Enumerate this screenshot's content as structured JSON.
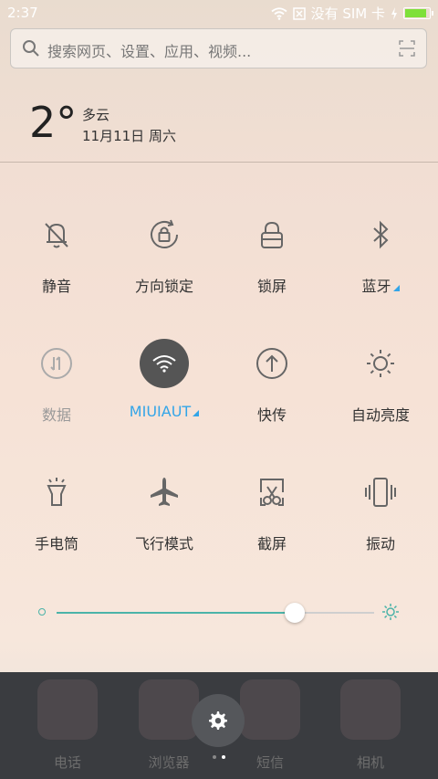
{
  "status": {
    "time": "2:37",
    "carrier": "没有 SIM 卡"
  },
  "search": {
    "placeholder": "搜索网页、设置、应用、视频..."
  },
  "weather": {
    "temp": "2°",
    "condition": "多云",
    "date": "11月11日 周六"
  },
  "toggles": [
    {
      "label": "静音",
      "icon": "bell-off-icon",
      "state": "off"
    },
    {
      "label": "方向锁定",
      "icon": "rotation-lock-icon",
      "state": "off"
    },
    {
      "label": "锁屏",
      "icon": "lock-icon",
      "state": "off"
    },
    {
      "label": "蓝牙",
      "icon": "bluetooth-icon",
      "state": "off",
      "has_menu": true
    },
    {
      "label": "数据",
      "icon": "mobile-data-icon",
      "state": "disabled"
    },
    {
      "label": "MIUIAUT",
      "icon": "wifi-icon",
      "state": "on",
      "has_menu": true
    },
    {
      "label": "快传",
      "icon": "share-upload-icon",
      "state": "off"
    },
    {
      "label": "自动亮度",
      "icon": "auto-brightness-icon",
      "state": "off"
    },
    {
      "label": "手电筒",
      "icon": "flashlight-icon",
      "state": "off"
    },
    {
      "label": "飞行模式",
      "icon": "airplane-icon",
      "state": "off"
    },
    {
      "label": "截屏",
      "icon": "screenshot-icon",
      "state": "off"
    },
    {
      "label": "振动",
      "icon": "vibrate-icon",
      "state": "off"
    }
  ],
  "brightness": {
    "level": 0.75
  },
  "dock": {
    "apps": [
      "电话",
      "浏览器",
      "短信",
      "相机"
    ]
  },
  "colors": {
    "accent": "#33a5e8",
    "slider": "#4bb3a8",
    "dock": "#3a3c40"
  }
}
